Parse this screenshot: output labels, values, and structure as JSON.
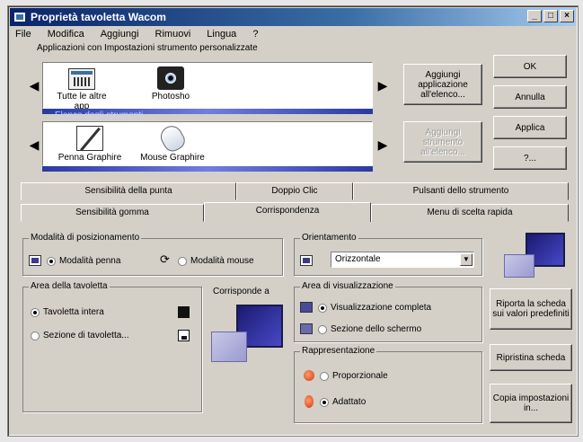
{
  "window": {
    "title": "Proprietà tavoletta Wacom",
    "controls": [
      "_",
      "□",
      "×"
    ]
  },
  "menu": [
    "File",
    "Modifica",
    "Aggiungi",
    "Rimuovi",
    "Lingua",
    "?"
  ],
  "apps": {
    "label": "Applicazioni con Impostazioni strumento personalizzate",
    "items": [
      {
        "label": "Tutte le altre app"
      },
      {
        "label": "Photosho"
      }
    ],
    "add_label": "Aggiungi applicazione all'elenco..."
  },
  "tools": {
    "label": "Elenco degli strumenti",
    "items": [
      {
        "label": "Penna Graphire"
      },
      {
        "label": "Mouse Graphire"
      }
    ],
    "add_label": "Aggiungi strumento all'elenco..."
  },
  "side_buttons": {
    "ok": "OK",
    "cancel": "Annulla",
    "apply": "Applica",
    "help": "?..."
  },
  "tabs_back": [
    "Sensibilità della punta",
    "Doppio Clic",
    "Pulsanti dello strumento"
  ],
  "tabs_front": [
    "Sensibilità gomma",
    "Corrispondenza",
    "Menu di scelta rapida"
  ],
  "active_tab": "Corrispondenza",
  "mode_group": {
    "legend": "Modalità di posizionamento",
    "pen": "Modalità penna",
    "mouse": "Modalità mouse",
    "selected": "pen"
  },
  "orientation": {
    "legend": "Orientamento",
    "value": "Orizzontale"
  },
  "tablet_area": {
    "legend": "Area della tavoletta",
    "full": "Tavoletta intera",
    "portion": "Sezione di tavoletta...",
    "selected": "full"
  },
  "maps_to": "Corrisponde a",
  "display_area": {
    "legend": "Area di visualizzazione",
    "full": "Visualizzazione completa",
    "portion": "Sezione dello schermo",
    "selected": "full"
  },
  "representation": {
    "legend": "Rappresentazione",
    "proportional": "Proporzionale",
    "fit": "Adattato",
    "selected": "fit"
  },
  "right_buttons": {
    "reset": "Riporta la scheda sui valori predefiniti",
    "restore": "Ripristina scheda",
    "copy": "Copia impostazioni in..."
  }
}
